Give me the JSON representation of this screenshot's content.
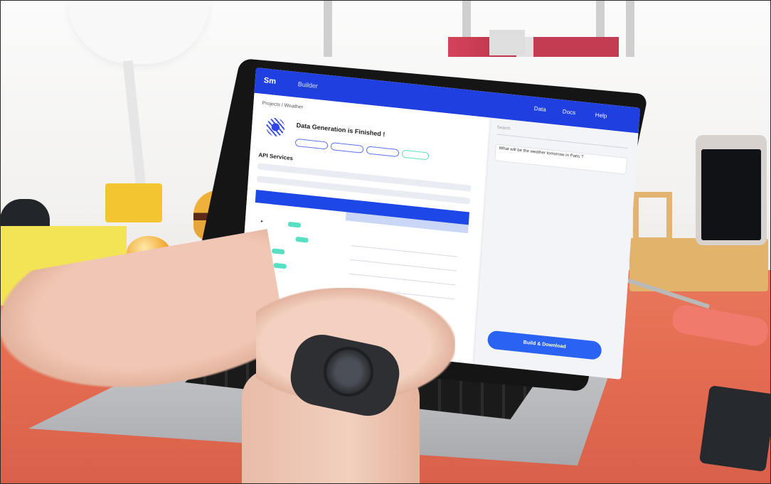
{
  "screen_app": {
    "brand": "Sm",
    "topbar_crumb": "Builder",
    "nav": [
      "Data",
      "Docs",
      "Help"
    ],
    "breadcrumb": "Projects / Weather",
    "card_title": "Data Generation is Finished !",
    "section_title": "API Services",
    "cta_label": "Build & Download",
    "search_placeholder": "Search",
    "message_preview": "What will be the weather tomorrow in Paris ?"
  },
  "objects": [
    "desk-lamp",
    "lego-brick",
    "toy-burger",
    "yellow-sponge",
    "black-pouch",
    "laptop",
    "smartphone",
    "wooden-phone-stand",
    "screwdriver",
    "notebook",
    "wristwatch"
  ],
  "colors": {
    "desk": "#e46d52",
    "wall": "#f4f2ef",
    "app_blue": "#1f3fe0",
    "accent_teal": "#59e0c4"
  }
}
